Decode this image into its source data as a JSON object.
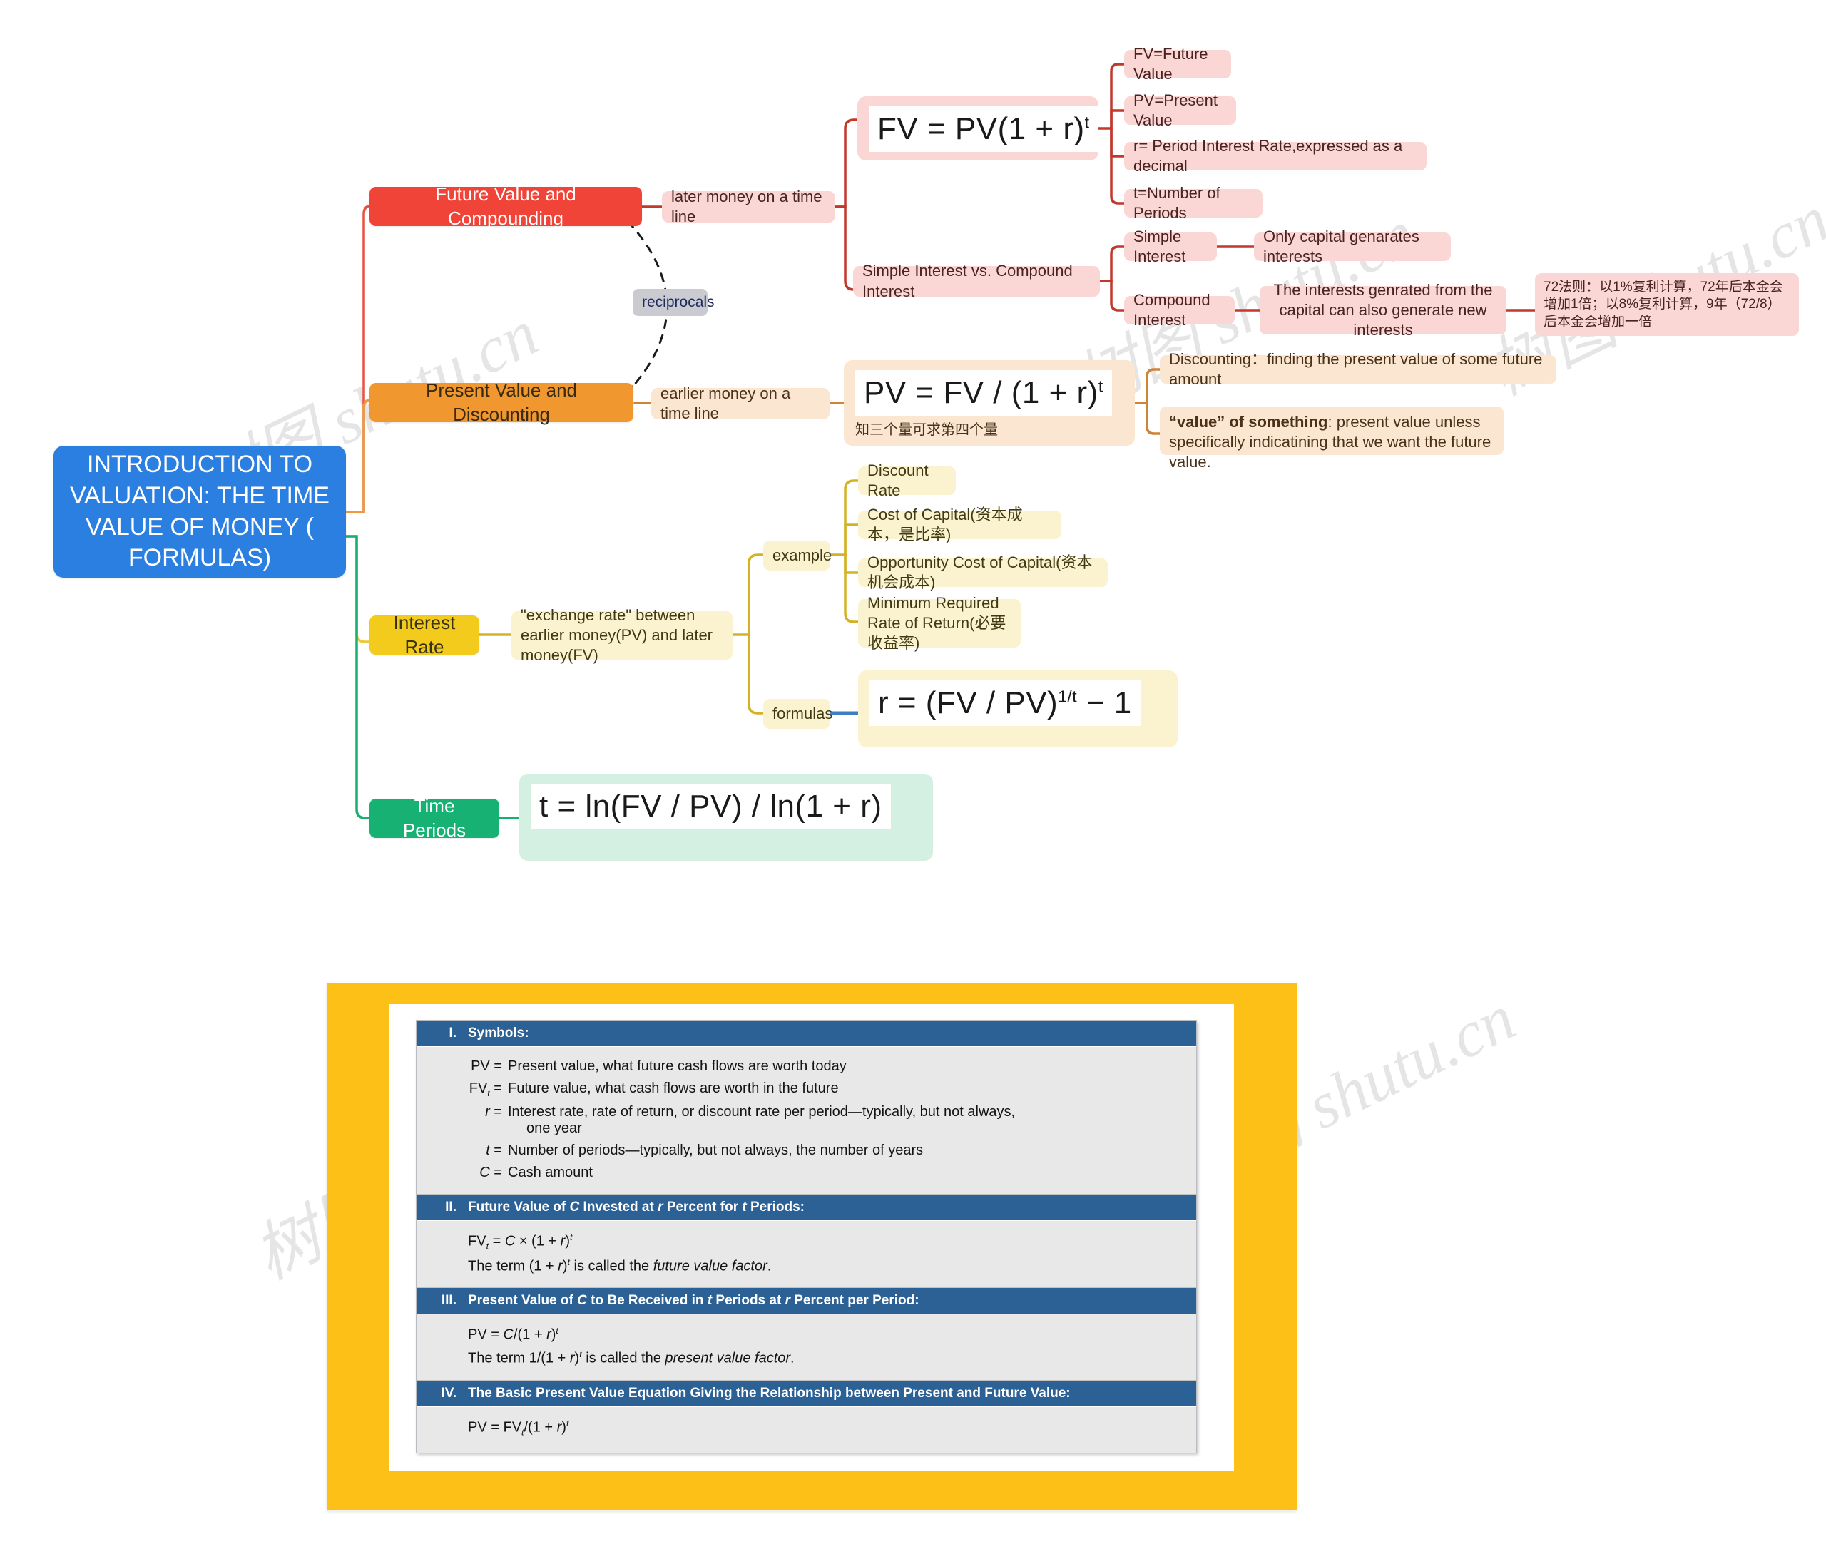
{
  "root": {
    "title": "INTRODUCTION TO VALUATION: THE TIME VALUE OF MONEY ( FORMULAS)"
  },
  "colors": {
    "root": "#2b7fe0",
    "red": "#f04438",
    "orange": "#f0982f",
    "yellow": "#f2cb1c",
    "green": "#16b173",
    "red_light": "#fad7d4",
    "orange_light": "#fbe6d2",
    "yellow_light": "#fbf3cf",
    "green_light": "#d3f0e2",
    "gray": "#c9cbd0",
    "panel_yellow": "#fcc017",
    "table_header_blue": "#2c6196",
    "table_body_gray": "#e8e8e8",
    "link_blue": "#3d7ec2"
  },
  "branches": {
    "future_value": {
      "label": "Future Value and Compounding",
      "link_label": "later money on a time line",
      "formula": "FV = PV(1 + r)",
      "formula_exp": "t",
      "definitions": [
        "FV=Future Value",
        "PV=Present Value",
        "r= Period Interest Rate,expressed as a decimal",
        "t=Number of Periods"
      ],
      "comparison": {
        "label": "Simple Interest vs. Compound Interest",
        "simple": {
          "label": "Simple Interest",
          "detail": "Only capital genarates interests"
        },
        "compound": {
          "label": "Compound Interest",
          "detail": "The interests genrated from the capital can also generate new interests",
          "note": "72法则：以1%复利计算，72年后本金会增加1倍；以8%复利计算，9年（72/8）后本金会增加一倍"
        }
      }
    },
    "present_value": {
      "label": "Present Value and Discounting",
      "link_label": "earlier money on a time line",
      "formula": "PV = FV / (1 + r)",
      "formula_exp": "t",
      "formula_subtext": "知三个量可求第四个量",
      "notes": [
        "Discounting：finding the present value of some future amount",
        "“value” of something: present value unless specifically indicatining that we want the future value."
      ],
      "note2_bold": "“value” of something",
      "note2_rest": ": present value unless specifically indicatining that we want the future value."
    },
    "interest_rate": {
      "label": "Interest Rate",
      "link_label": "\"exchange rate\" between earlier money(PV) and later money(FV)",
      "example_label": "example",
      "formulas_label": "formulas",
      "examples": [
        "Discount Rate",
        "Cost of Capital(资本成本，是比率)",
        "Opportunity Cost of Capital(资本机会成本)",
        "Minimum Required Rate of Return(必要收益率)"
      ],
      "formula": "r = (FV / PV)",
      "formula_exp": "1/t",
      "formula_tail": " − 1"
    },
    "time_periods": {
      "label": "Time Periods",
      "formula": "t = ln(FV / PV) / ln(1 + r)"
    },
    "reciprocals_label": "reciprocals"
  },
  "panel": {
    "sections": [
      {
        "num": "I.",
        "title": "Symbols:",
        "rows": [
          {
            "sym": "PV =",
            "txt": "Present value, what future cash flows are worth today"
          },
          {
            "sym": "FVt =",
            "txt": "Future value, what cash flows are worth in the future"
          },
          {
            "sym": "r =",
            "txt": "Interest rate, rate of return, or discount rate per period—typically, but not always,"
          },
          {
            "sym": "",
            "txt": "one year"
          },
          {
            "sym": "t =",
            "txt": "Number of periods—typically, but not always, the number of years"
          },
          {
            "sym": "C =",
            "txt": "Cash amount"
          }
        ]
      },
      {
        "num": "II.",
        "title": "Future Value of C Invested at r Percent for t Periods:",
        "lines": [
          "FVt = C × (1 + r)t",
          "The term (1 + r)t is called the future value factor."
        ]
      },
      {
        "num": "III.",
        "title": "Present Value of C to Be Received in t Periods at r Percent per Period:",
        "lines": [
          "PV = C/(1 + r)t",
          "The term 1/(1 + r)t is called the present value factor."
        ]
      },
      {
        "num": "IV.",
        "title": "The Basic Present Value Equation Giving the Relationship between Present and Future Value:",
        "lines": [
          "PV = FVt /(1 + r)t"
        ]
      }
    ]
  },
  "watermarks": [
    {
      "text": "树图 shutu.cn"
    },
    {
      "text": "树图 shutu.cn"
    },
    {
      "text": "树图 shutu.cn"
    },
    {
      "text": "树图 shutu.cn"
    },
    {
      "text": "树图 shutu.cn"
    }
  ]
}
